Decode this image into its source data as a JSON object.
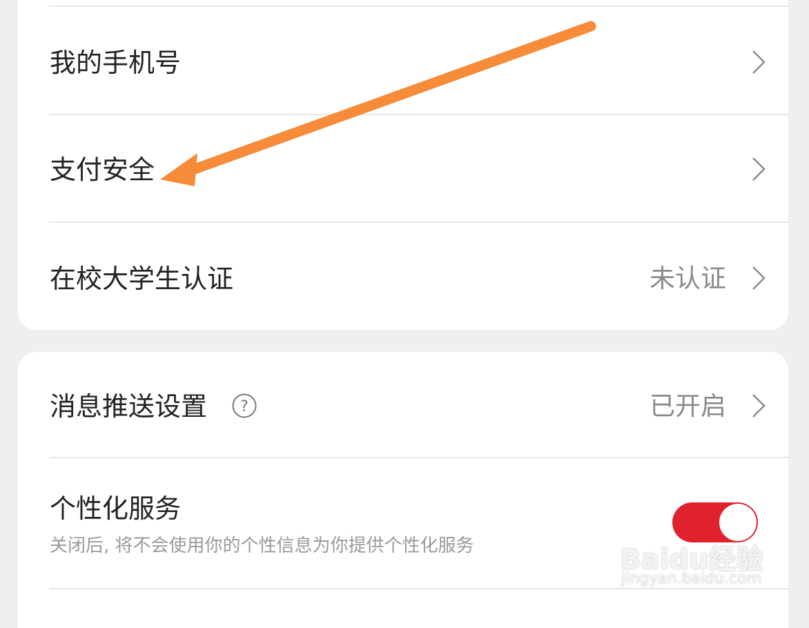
{
  "account_section": {
    "items": [
      {
        "label": "我的手机号",
        "value": ""
      },
      {
        "label": "支付安全",
        "value": ""
      },
      {
        "label": "在校大学生认证",
        "value": "未认证"
      }
    ]
  },
  "settings_section": {
    "push": {
      "label": "消息推送设置",
      "value": "已开启",
      "help_icon": "question-circle-icon"
    },
    "personalized": {
      "label": "个性化服务",
      "description": "关闭后, 将不会使用你的个性信息为你提供个性化服务",
      "toggle_on": true
    }
  },
  "annotation": {
    "arrow_color": "#f68b3a",
    "points_to": "支付安全"
  },
  "watermark": {
    "logo": "Baidu经验",
    "url": "jingyan.baidu.com"
  },
  "colors": {
    "background": "#efefef",
    "card": "#ffffff",
    "toggle_on": "#e0222f",
    "value_text": "#8a8a8a"
  }
}
